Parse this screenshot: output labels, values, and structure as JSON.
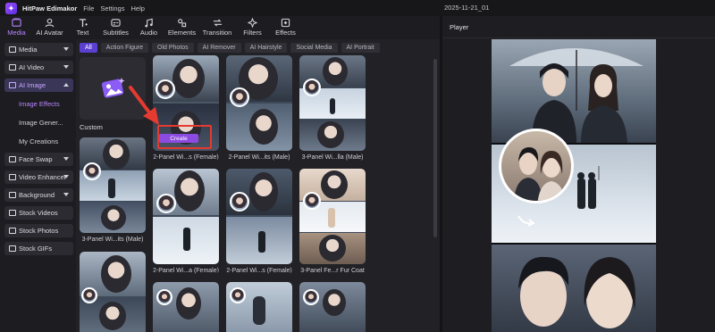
{
  "app": {
    "name": "HitPaw Edimakor",
    "menu": [
      "File",
      "Settings",
      "Help"
    ],
    "project_date": "2025-11-21_01"
  },
  "toolbar": [
    {
      "label": "Media",
      "icon": "media-icon"
    },
    {
      "label": "AI Avatar",
      "icon": "ai-avatar-icon"
    },
    {
      "label": "Text",
      "icon": "text-icon"
    },
    {
      "label": "Subtitles",
      "icon": "subtitles-icon"
    },
    {
      "label": "Audio",
      "icon": "audio-icon"
    },
    {
      "label": "Elements",
      "icon": "elements-icon"
    },
    {
      "label": "Transition",
      "icon": "transition-icon"
    },
    {
      "label": "Filters",
      "icon": "filters-icon"
    },
    {
      "label": "Effects",
      "icon": "effects-icon"
    }
  ],
  "sidebar": {
    "media": "Media",
    "ai_video": "AI Video",
    "ai_image": "AI Image",
    "sub": [
      "Image Effects",
      "Image Gener...",
      "My Creations"
    ],
    "face_swap": "Face Swap",
    "video_enhancer": "Video Enhancer",
    "background": "Background",
    "stock_videos": "Stock Videos",
    "stock_photos": "Stock Photos",
    "stock_gifs": "Stock GIFs"
  },
  "filters": [
    "All",
    "Action Figure",
    "Old Photos",
    "AI Remover",
    "AI Hairstyle",
    "Social Media",
    "AI Portrait"
  ],
  "grid": {
    "custom_label": "Custom",
    "create_label": "Create",
    "cards": [
      "2-Panel Wi...s (Female)",
      "2-Panel Wi...its (Male)",
      "3-Panel Wi...lla (Male)",
      "3-Panel Wi...its (Male)",
      "2-Panel Wi...a (Female)",
      "2-Panel Wi...s (Female)",
      "3-Panel Fe...r Fur Coat"
    ]
  },
  "player": {
    "title": "Player"
  },
  "colors": {
    "accent": "#b785ff",
    "chip_active": "#5b3fd0",
    "create": "#8c4be0",
    "highlight": "#e53a2f"
  }
}
